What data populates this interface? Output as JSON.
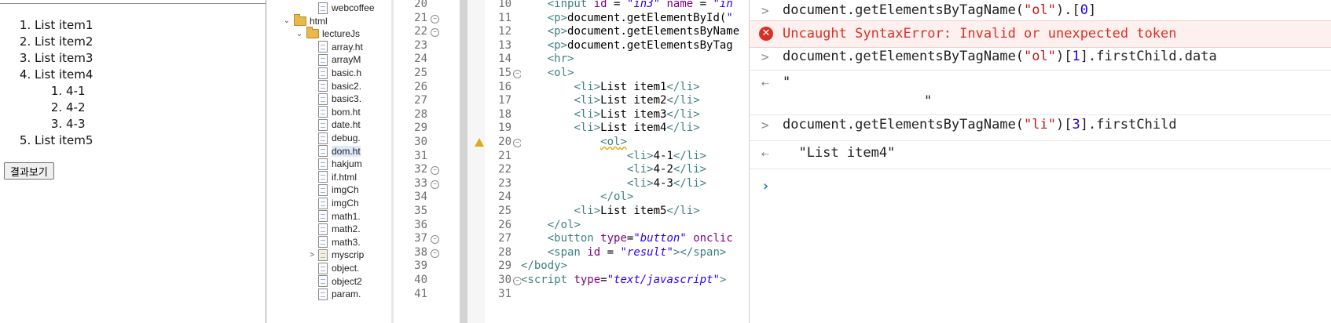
{
  "preview": {
    "list_items": [
      "List item1",
      "List item2",
      "List item3",
      "List item4",
      "List item5"
    ],
    "nested_items": [
      "4-1",
      "4-2",
      "4-3"
    ],
    "button_label": "결과보기"
  },
  "explorer": {
    "rows": [
      {
        "label": "webcoffee",
        "type": "file",
        "indent": 2
      },
      {
        "label": "html",
        "type": "folder",
        "indent": 0,
        "twisty": "⌄"
      },
      {
        "label": "lectureJs",
        "type": "folder",
        "indent": 1,
        "twisty": "⌄"
      },
      {
        "label": "array.ht",
        "type": "file",
        "indent": 2
      },
      {
        "label": "arrayM",
        "type": "file",
        "indent": 2
      },
      {
        "label": "basic.h",
        "type": "file",
        "indent": 2
      },
      {
        "label": "basic2.",
        "type": "file",
        "indent": 2
      },
      {
        "label": "basic3.",
        "type": "file",
        "indent": 2
      },
      {
        "label": "bom.ht",
        "type": "file",
        "indent": 2
      },
      {
        "label": "date.ht",
        "type": "file",
        "indent": 2
      },
      {
        "label": "debug.",
        "type": "file",
        "indent": 2
      },
      {
        "label": "dom.ht",
        "type": "file",
        "indent": 2,
        "selected": true
      },
      {
        "label": "hakjum",
        "type": "file",
        "indent": 2
      },
      {
        "label": "if.html",
        "type": "file",
        "indent": 2
      },
      {
        "label": "imgCh",
        "type": "file",
        "indent": 2
      },
      {
        "label": "imgCh",
        "type": "file",
        "indent": 2
      },
      {
        "label": "math1.",
        "type": "file",
        "indent": 2
      },
      {
        "label": "math2.",
        "type": "file",
        "indent": 2
      },
      {
        "label": "math3.",
        "type": "file",
        "indent": 2
      },
      {
        "label": "myscrip",
        "type": "jsfolder",
        "indent": 2,
        "twisty": ">"
      },
      {
        "label": "object.",
        "type": "file",
        "indent": 2
      },
      {
        "label": "object2",
        "type": "file",
        "indent": 2
      },
      {
        "label": "param.",
        "type": "file",
        "indent": 2
      }
    ]
  },
  "gutter_a": {
    "lines": [
      "20",
      "21",
      "22",
      "23",
      "24",
      "25",
      "26",
      "27",
      "28",
      "29",
      "30",
      "31",
      "32",
      "33",
      "34",
      "35",
      "36",
      "37",
      "38",
      "39",
      "40",
      "41"
    ],
    "folds": [
      "21",
      "22",
      "32",
      "33",
      "37",
      "38"
    ]
  },
  "gutter_b": {
    "lines": [
      "10",
      "11",
      "12",
      "13",
      "14",
      "15",
      "16",
      "17",
      "18",
      "19",
      "20",
      "21",
      "22",
      "23",
      "24",
      "25",
      "26",
      "27",
      "28",
      "29",
      "30",
      "31"
    ],
    "folds": [
      "15",
      "20",
      "30"
    ],
    "warning_line": "20"
  },
  "code": {
    "lines": [
      "    <input id = \"in3\" name = \"in",
      "    <p>document.getElementById(\"",
      "    <p>document.getElementsByName",
      "    <p>document.getElementsByTag",
      "    <hr>",
      "    <ol>",
      "        <li>List item1</li>",
      "        <li>List item2</li>",
      "        <li>List item3</li>",
      "        <li>List item4</li>",
      "            <ol>",
      "                <li>4-1</li>",
      "                <li>4-2</li>",
      "                <li>4-3</li>",
      "            </ol>",
      "        <li>List item5</li>",
      "    </ol>",
      "    <button type=\"button\" onclic",
      "    <span id = \"result\"></span>",
      "</body>",
      "<script type=\"text/javascript\">",
      ""
    ]
  },
  "console": {
    "entries": [
      {
        "kind": "input",
        "text": "document.getElementsByTagName(\"ol\").[0]"
      },
      {
        "kind": "error",
        "text": "Uncaught SyntaxError: Invalid or unexpected token"
      },
      {
        "kind": "input",
        "text": "document.getElementsByTagName(\"ol\")[1].firstChild.data"
      },
      {
        "kind": "output",
        "text": "\"",
        "text2": "\""
      },
      {
        "kind": "input",
        "text": "document.getElementsByTagName(\"li\")[3].firstChild"
      },
      {
        "kind": "output",
        "text": "  \"List item4\""
      }
    ],
    "prompt_glyph": "›"
  },
  "colors": {
    "error_red": "#d93025",
    "string_red": "#c41a16",
    "number_blue": "#1c00cf",
    "prompt_blue": "#1a73e8",
    "tag_teal": "#3f7f7f",
    "attr_purple": "#7f007f",
    "value_blue": "#2a00ff"
  }
}
